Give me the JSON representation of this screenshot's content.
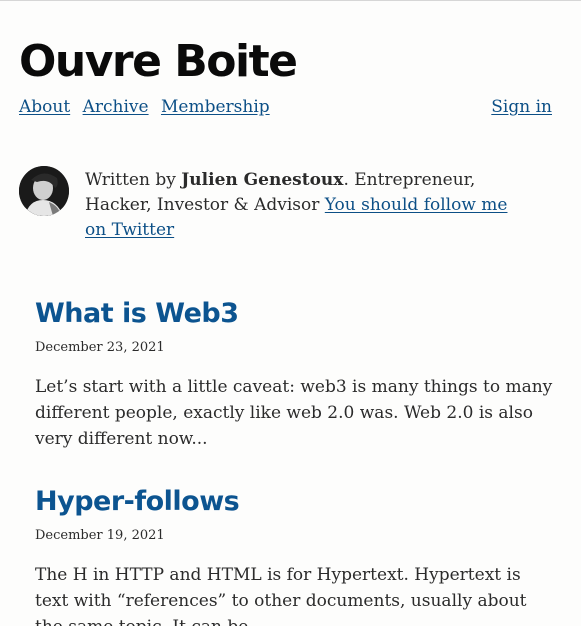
{
  "site": {
    "title": "Ouvre Boite"
  },
  "nav": {
    "items": [
      {
        "label": "About"
      },
      {
        "label": "Archive"
      },
      {
        "label": "Membership"
      }
    ],
    "signin_label": "Sign in"
  },
  "author": {
    "prefix": "Written by ",
    "name": "Julien Genestoux",
    "description": ". Entrepreneur, Hacker, Investor & Advisor ",
    "twitter_link": "You should follow me on Twitter"
  },
  "posts": [
    {
      "title": "What is Web3",
      "date": "December 23, 2021",
      "excerpt": "Let’s start with a little caveat: web3 is many things to many different people, exactly like web 2.0 was. Web 2.0 is also very different now..."
    },
    {
      "title": "Hyper-follows",
      "date": "December 19, 2021",
      "excerpt": "The H in HTTP and HTML is for Hypertext. Hypertext is text with “references” to other documents, usually about the same topic. It can be..."
    }
  ],
  "colors": {
    "link": "#0c4f86",
    "post_title": "#0c5490",
    "text": "#2b2b2b",
    "background": "#fdfdfc"
  }
}
